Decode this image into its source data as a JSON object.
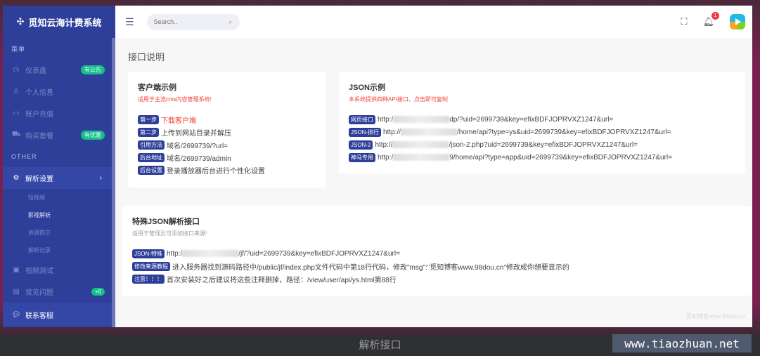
{
  "app": {
    "brand": "觅知云海计费系统",
    "brand_icon": "move-icon"
  },
  "topbar": {
    "search_placeholder": "Search..",
    "notification_count": "1"
  },
  "sidebar": {
    "section_menu": "菜单",
    "section_other": "OTHER",
    "items": [
      {
        "label": "仪表盘",
        "icon": "dashboard-icon",
        "badge": "有公告"
      },
      {
        "label": "个人信息",
        "icon": "user-icon",
        "badge": ""
      },
      {
        "label": "账户充值",
        "icon": "card-icon",
        "badge": ""
      },
      {
        "label": "购买套餐",
        "icon": "cart-icon",
        "badge": "有优惠"
      }
    ],
    "other_items": [
      {
        "label": "解析设置",
        "icon": "gear-icon",
        "expanded": true,
        "children": [
          "短视频",
          "影视解析",
          "资源提交",
          "解析记录"
        ],
        "current_child": "影视解析"
      },
      {
        "label": "视频测试",
        "icon": "video-icon",
        "badge": ""
      },
      {
        "label": "常见问题",
        "icon": "doc-icon",
        "badge": "+6"
      },
      {
        "label": "联系客服",
        "icon": "chat-icon",
        "badge": ""
      }
    ]
  },
  "main": {
    "page_title": "接口说明",
    "client_card": {
      "title": "客户端示例",
      "subtitle": "适用于主流cms内容管理系统!",
      "rows": [
        {
          "tag": "第一步",
          "text": "下载客户端",
          "highlight": true
        },
        {
          "tag": "第二步",
          "text": "上传到网站目录并解压",
          "highlight": false
        },
        {
          "tag": "引用方法",
          "text": "域名/2699739/?url=",
          "highlight": false
        },
        {
          "tag": "后台地址",
          "text": "域名/2699739/admin",
          "highlight": false
        },
        {
          "tag": "后台设置",
          "text": "登录播放器后台进行个性化设置",
          "highlight": false
        }
      ]
    },
    "json_card": {
      "title": "JSON示例",
      "subtitle": "本系统提供四种API接口、点击即可复制",
      "rows": [
        {
          "tag": "网页接口",
          "prefix": "http:/",
          "suffix": "dp/?uid=2699739&key=efixBDFJOPRVXZ1247&url="
        },
        {
          "tag": "JSON-排行",
          "prefix": "http://",
          "suffix": "/home/api?type=ys&uid=2699739&key=efixBDFJOPRVXZ1247&url="
        },
        {
          "tag": "JSON-2",
          "prefix": "http://",
          "suffix": "/json-2.php?uid=2699739&key=efixBDFJOPRVXZ1247&url="
        },
        {
          "tag": "神马专用",
          "prefix": "http:/",
          "suffix": "9/home/api?type=app&uid=2699739&key=efixBDFJOPRVXZ1247&url="
        }
      ]
    },
    "special_card": {
      "title": "特殊JSON解析接口",
      "subtitle": "适用于管理员可添加接口来源!",
      "rows": [
        {
          "tag": "JSON-特殊",
          "text": "http:/",
          "suffix": "/jf/?uid=2699739&key=efixBDFJOPRVXZ1247&url="
        },
        {
          "tag": "修改来源教程",
          "text": "进入服务器找到源码路径中/public/jf/index.php文件代码中第18行代码，修改\"msg\":\"觅知博客www.98dou.cn\"修改成你想要显示的"
        },
        {
          "tag": "注意！！！",
          "text": "首次安装好之后建议将这些注释删掉，路径：/view/user/api/ys.html第88行"
        }
      ]
    },
    "watermark": "觅知博客www.98dou.cn"
  },
  "caption": "解析接口",
  "site_badge": "www.tiaozhuan.net",
  "colors": {
    "sidebar": "#2e3f9a",
    "badge_green": "#14c08a",
    "tag_blue": "#2e3f9a",
    "warning_red": "#f44336",
    "frame": "#7a2050"
  }
}
